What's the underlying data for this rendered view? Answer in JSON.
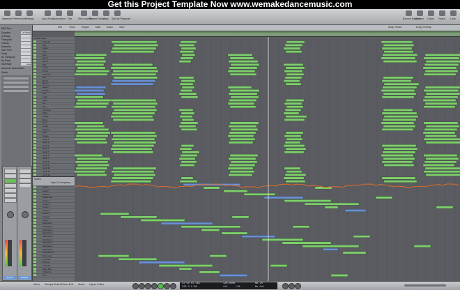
{
  "banner": {
    "text": "Get this Project Template Now www.wemakedancemusic.com"
  },
  "toolbar": {
    "left_buttons": [
      "Inspector",
      "Preferences",
      "Settings",
      "Auto Zoom",
      "Automation",
      "Flex",
      "Set Locators",
      "Repeat Section",
      "Crop",
      "Split by Playhead"
    ],
    "right_buttons": [
      "Bounce Regions",
      "Bounce",
      "Colors",
      "Notes",
      "Lists",
      "Media"
    ]
  },
  "inspector": {
    "region_header": "MIDI Thru",
    "rows": [
      {
        "k": "Quantize",
        "v": "off (3840)"
      },
      {
        "k": "Q-Swing",
        "v": ""
      },
      {
        "k": "Transpose",
        "v": ""
      },
      {
        "k": "Velocity",
        "v": ""
      },
      {
        "k": "Dynamics",
        "v": ""
      },
      {
        "k": "Gate Time",
        "v": ""
      },
      {
        "k": "Delay",
        "v": ""
      },
      {
        "k": "No Transpose",
        "v": ""
      },
      {
        "k": "No Reset",
        "v": ""
      },
      {
        "k": "Staff Style",
        "v": "Auto"
      }
    ],
    "advanced": "Advanced Quantization",
    "track_header": "Synths",
    "strip_names": [
      "Synths",
      "Outputs"
    ]
  },
  "arrange_menu": [
    "Edit",
    "Track",
    "Region",
    "MIDI",
    "Audio",
    "View"
  ],
  "arrange_right": [
    "Snap: Smart",
    "Drag: Overlap"
  ],
  "folder_label": "Global Tracks",
  "tracks": [
    "Drum Kit",
    "Kick",
    "Snare",
    "Clap",
    "Hats",
    "Perc 1",
    "Perc 2",
    "Ride",
    "Crash",
    "FX Up",
    "FX Down",
    "Sub",
    "Bass 1",
    "Bass 2",
    "Bass 3",
    "Chords",
    "Pad",
    "Lead",
    "Pluck",
    "Arp",
    "Vox",
    "Vox Chop",
    "Piano",
    "Strings",
    "Brass",
    "Noise",
    "Impact",
    "Reverse",
    "Riser",
    "Sweep",
    "Synth 1",
    "Synth 2",
    "Synth 3",
    "Synth 4",
    "Synth 5",
    "Synth 6",
    "Synth 7",
    "Synth 8",
    "Synth 9",
    "Synth 10",
    "Synth 11",
    "Synth 12",
    "Synth 13",
    "Synth 14",
    "Synth 15",
    "Lead 2",
    "Lead 3",
    "Bass FX",
    "Master Bus",
    "Group 1",
    "Group 2",
    "Group 3",
    "Group 4",
    "Group 5",
    "Group 6",
    "Group 7",
    "Sidechain 1",
    "Sidechain 2",
    "Sidechain 3",
    "Sidechain 4",
    "Sidechain 5",
    "Sidechain 6",
    "Sidechain 7",
    "Sidechain 8",
    "Sidechain 9",
    "Sidechain 10",
    "Perc Loop",
    "Top Loop",
    "FX Loop",
    "Vocal FX",
    "Outro Pad",
    "Ambience",
    "Print"
  ],
  "sub_toolbar": {
    "label_left": "Synths",
    "label_right": "High Cut Frequency"
  },
  "bottom_tabs": [
    "Mixer",
    "Sample Editor",
    "Piano Roll",
    "Score",
    "Hyper Editor"
  ],
  "lcd": {
    "position": "21 04 01 161",
    "position2": "123 3 2 96",
    "tempo": "128.0000",
    "sig": "4/4",
    "division": "/16",
    "in": "No In",
    "out": "No Out"
  },
  "colors": {
    "green_region": "#7ed06b",
    "blue_region": "#6a8fd8",
    "orange_automation": "#e06b2a",
    "ruler": "#7c9c79"
  }
}
